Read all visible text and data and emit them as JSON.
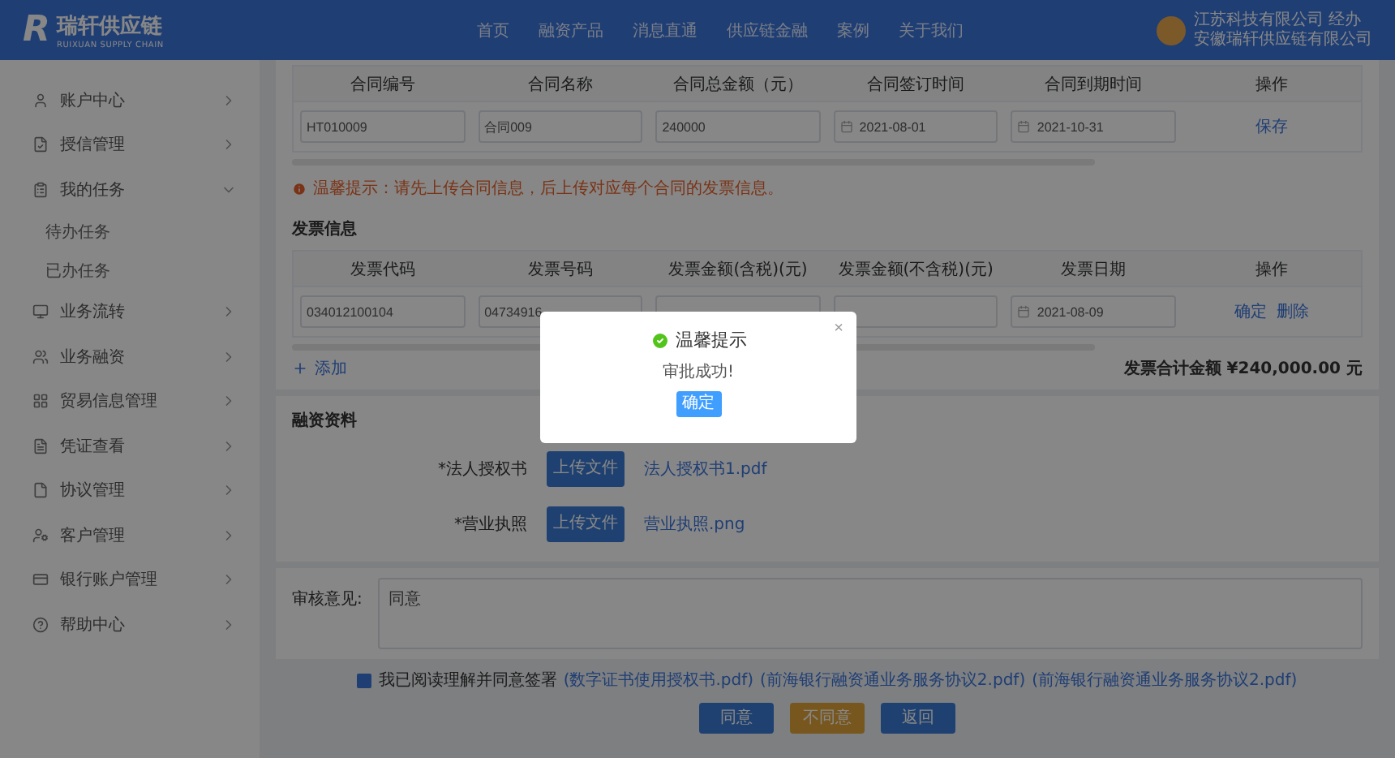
{
  "header": {
    "logo": {
      "mark": "R",
      "name": "瑞轩供应链",
      "subtitle": "RUIXUAN SUPPLY CHAIN"
    },
    "nav": [
      "首页",
      "融资产品",
      "消息直通",
      "供应链金融",
      "案例",
      "关于我们"
    ],
    "user": {
      "name": "江苏科技有限公司 经办",
      "company": "安徽瑞轩供应链有限公司"
    }
  },
  "sidebar": {
    "items": [
      {
        "label": "账户中心",
        "expanded": false
      },
      {
        "label": "授信管理",
        "expanded": false
      },
      {
        "label": "我的任务",
        "expanded": true,
        "children": [
          {
            "label": "待办任务"
          },
          {
            "label": "已办任务"
          }
        ]
      },
      {
        "label": "业务流转",
        "expanded": false
      },
      {
        "label": "业务融资",
        "expanded": false
      },
      {
        "label": "贸易信息管理",
        "expanded": false
      },
      {
        "label": "凭证查看",
        "expanded": false
      },
      {
        "label": "协议管理",
        "expanded": false
      },
      {
        "label": "客户管理",
        "expanded": false
      },
      {
        "label": "银行账户管理",
        "expanded": false
      },
      {
        "label": "帮助中心",
        "expanded": false
      }
    ]
  },
  "contract_table": {
    "columns": [
      "合同编号",
      "合同名称",
      "合同总金额（元）",
      "合同签订时间",
      "合同到期时间",
      "操作"
    ],
    "rows": [
      {
        "cells": [
          {
            "kind": "text",
            "value": "HT010009"
          },
          {
            "kind": "text",
            "value": "合同009"
          },
          {
            "kind": "text",
            "value": "240000"
          },
          {
            "kind": "date",
            "value": "2021-08-01"
          },
          {
            "kind": "date",
            "value": "2021-10-31"
          }
        ],
        "actions": [
          "保存"
        ]
      }
    ]
  },
  "warning": "温馨提示：请先上传合同信息，后上传对应每个合同的发票信息。",
  "invoice_section": {
    "title": "发票信息",
    "columns": [
      "发票代码",
      "发票号码",
      "发票金额(含税)(元)",
      "发票金额(不含税)(元)",
      "发票日期",
      "操作"
    ],
    "rows": [
      {
        "cells": [
          {
            "kind": "text",
            "value": "034012100104"
          },
          {
            "kind": "text",
            "value": "04734916"
          },
          {
            "kind": "text"
          },
          {
            "kind": "text"
          },
          {
            "kind": "date",
            "value": "2021-08-09"
          }
        ],
        "actions": [
          "确定",
          "删除"
        ]
      }
    ],
    "add_label": "添加",
    "total": "发票合计金额 ¥240,000.00 元"
  },
  "financing": {
    "title": "融资资料",
    "files": [
      {
        "label": "*法人授权书",
        "button": "上传文件",
        "file": "法人授权书1.pdf"
      },
      {
        "label": "*营业执照",
        "button": "上传文件",
        "file": "营业执照.png"
      }
    ]
  },
  "review": {
    "label": "审核意见:",
    "value": "同意"
  },
  "agreement": {
    "checked": true,
    "text": "我已阅读理解并同意签署",
    "links": [
      "(数字证书使用授权书.pdf)",
      "(前海银行融资通业务服务协议2.pdf)",
      "(前海银行融资通业务服务协议2.pdf)"
    ]
  },
  "actions": [
    {
      "label": "同意",
      "kind": "primary"
    },
    {
      "label": "不同意",
      "kind": "warning"
    },
    {
      "label": "返回",
      "kind": "primary"
    }
  ],
  "modal": {
    "title": "温馨提示",
    "message": "审批成功!",
    "button": "确定",
    "close": "×"
  }
}
